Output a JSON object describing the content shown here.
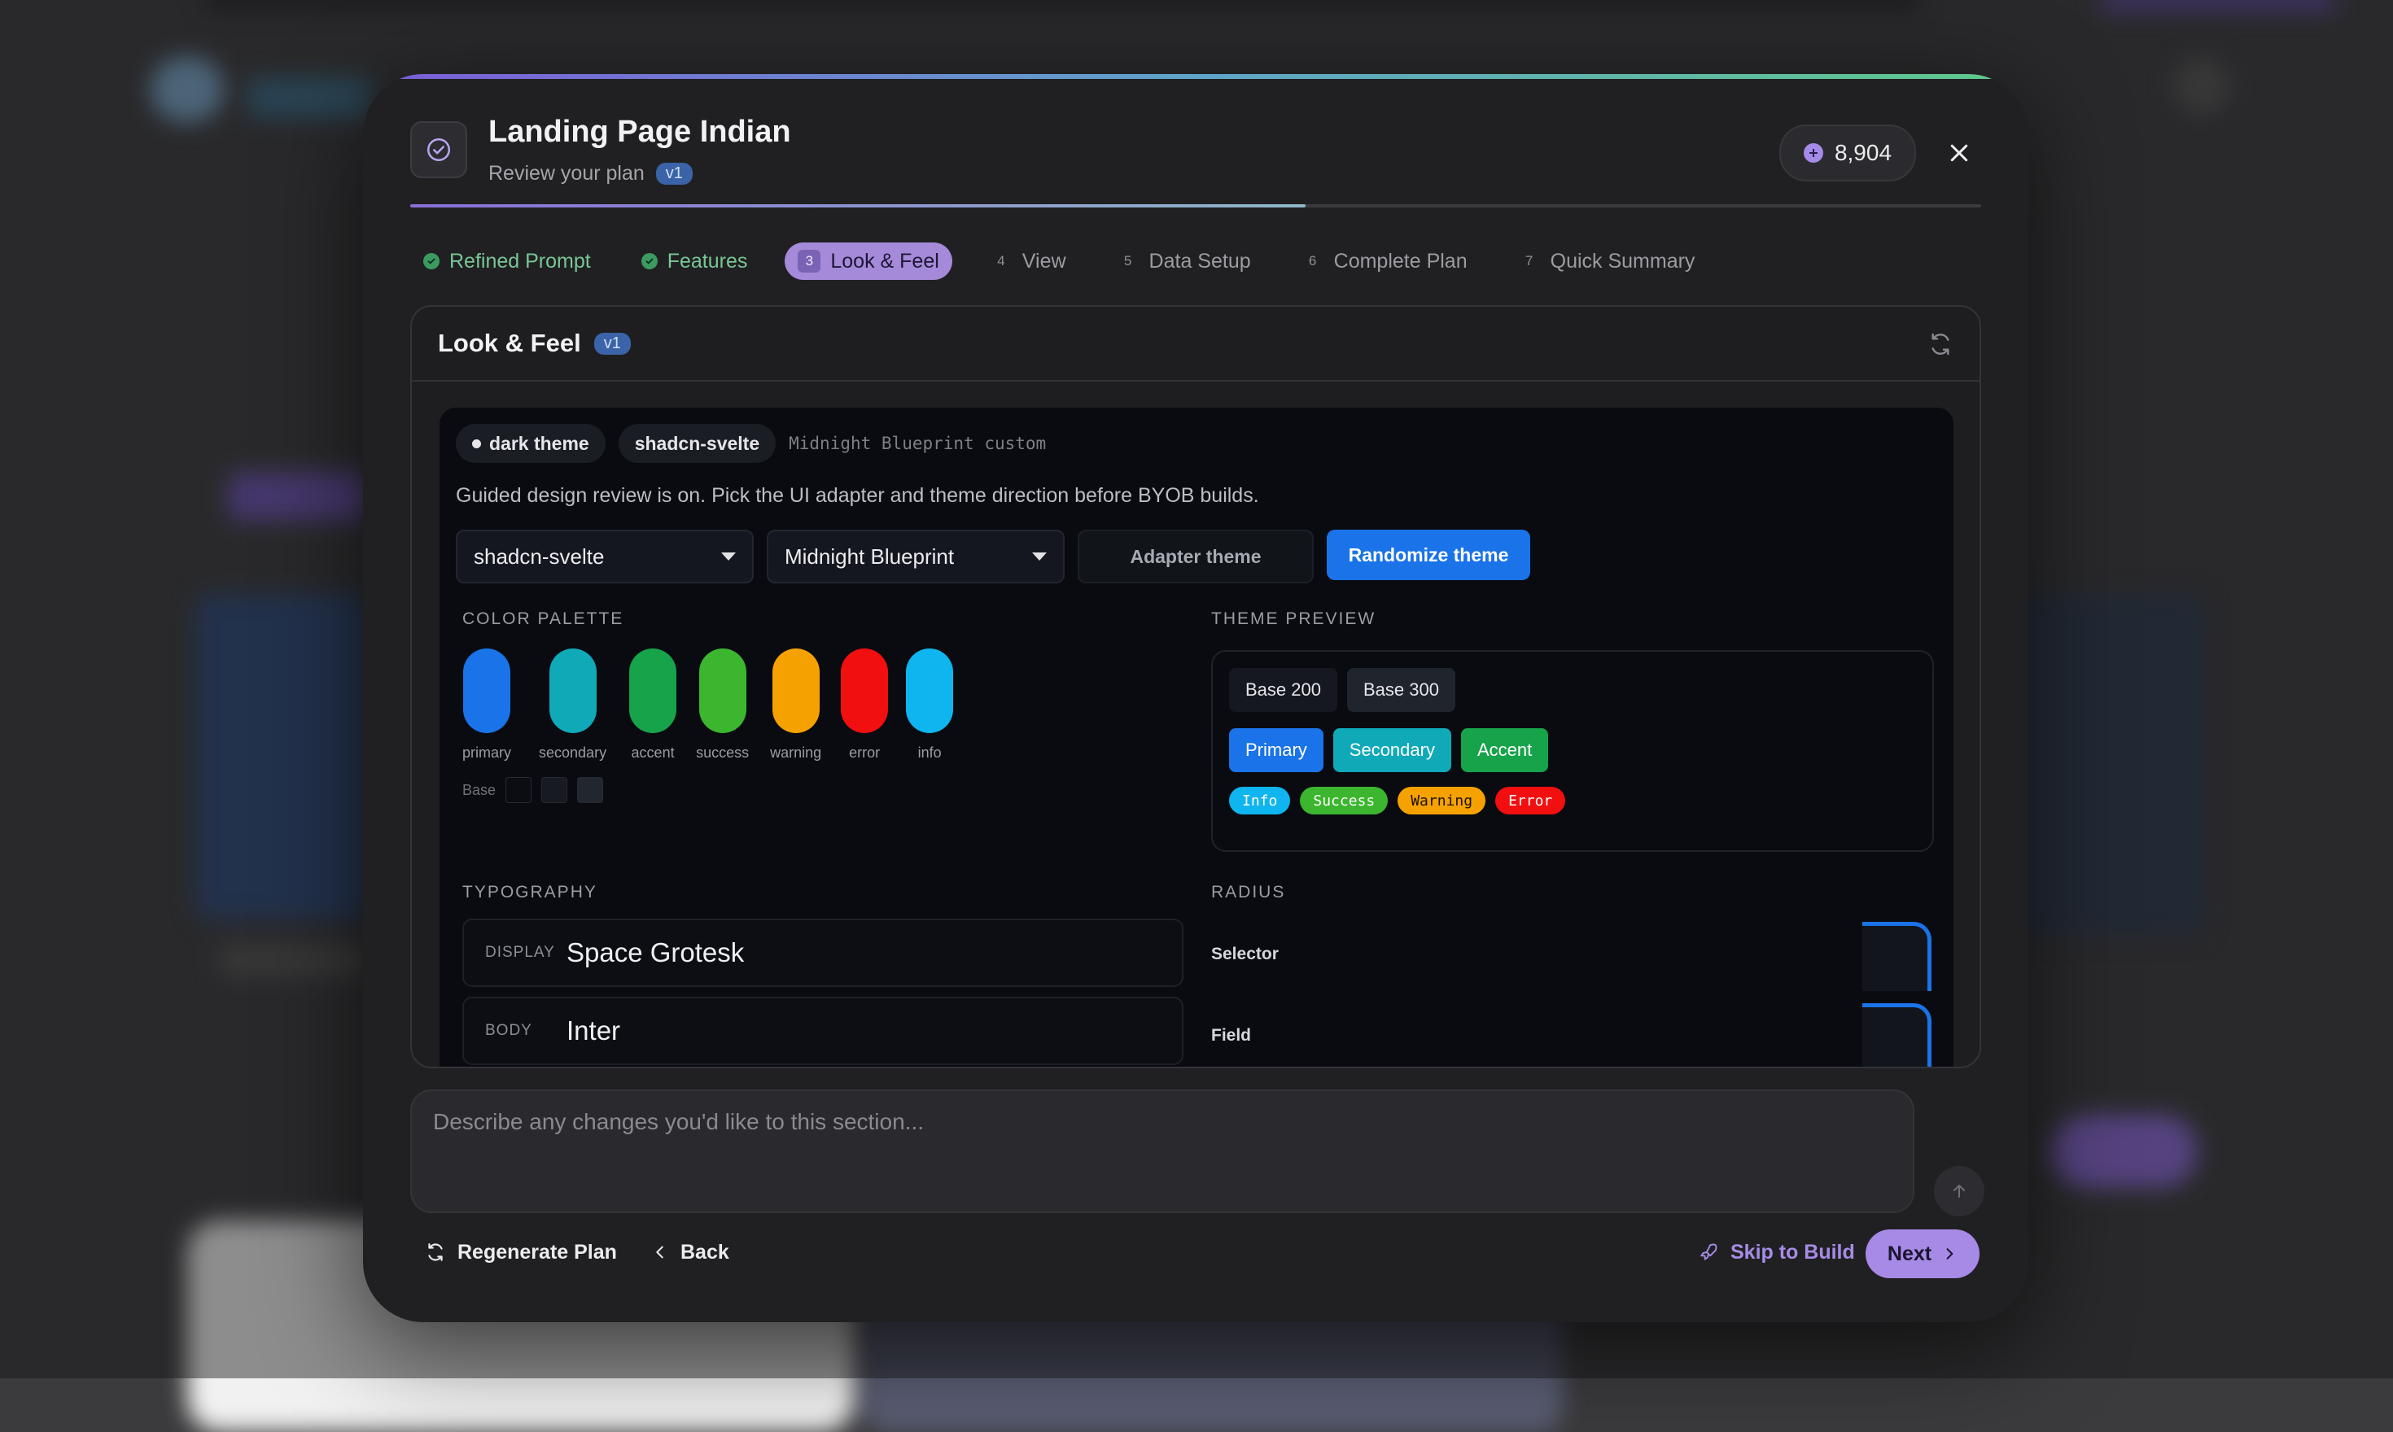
{
  "modal": {
    "title": "Landing Page Indian",
    "subtitle": "Review your plan",
    "version_badge": "v1",
    "credits": "8,904",
    "progress_fraction": 0.57
  },
  "steps": [
    {
      "label": "Refined Prompt",
      "state": "done",
      "num": ""
    },
    {
      "label": "Features",
      "state": "done",
      "num": ""
    },
    {
      "label": "Look & Feel",
      "state": "active",
      "num": "3"
    },
    {
      "label": "View",
      "state": "todo",
      "num": "4"
    },
    {
      "label": "Data Setup",
      "state": "todo",
      "num": "5"
    },
    {
      "label": "Complete Plan",
      "state": "todo",
      "num": "6"
    },
    {
      "label": "Quick Summary",
      "state": "todo",
      "num": "7"
    }
  ],
  "section": {
    "title": "Look & Feel",
    "version_badge": "v1",
    "tags": {
      "theme_mode": "dark theme",
      "adapter": "shadcn-svelte",
      "note": "Midnight Blueprint custom"
    },
    "guided_text": "Guided design review is on. Pick the UI adapter and theme direction before BYOB builds.",
    "adapter_select": "shadcn-svelte",
    "theme_select": "Midnight Blueprint",
    "adapter_theme_btn": "Adapter theme",
    "randomize_btn": "Randomize theme",
    "palette_label": "COLOR PALETTE",
    "palette": [
      {
        "name": "primary",
        "color": "#1a73e8"
      },
      {
        "name": "secondary",
        "color": "#0fa9b8"
      },
      {
        "name": "accent",
        "color": "#16a34a"
      },
      {
        "name": "success",
        "color": "#3bb62e"
      },
      {
        "name": "warning",
        "color": "#f5a200"
      },
      {
        "name": "error",
        "color": "#f10f0f"
      },
      {
        "name": "info",
        "color": "#0fb5ee"
      }
    ],
    "base_label": "Base",
    "base_colors": [
      "#0b0d12",
      "#171a21",
      "#22262e"
    ],
    "preview_label": "THEME PREVIEW",
    "preview": {
      "base200": "Base 200",
      "base300": "Base 300",
      "primary": "Primary",
      "secondary": "Secondary",
      "accent": "Accent",
      "badges": {
        "info": "Info",
        "success": "Success",
        "warning": "Warning",
        "error": "Error"
      }
    },
    "typography_label": "TYPOGRAPHY",
    "fonts": [
      {
        "kind": "DISPLAY",
        "name": "Space Grotesk"
      },
      {
        "kind": "BODY",
        "name": "Inter"
      }
    ],
    "radius_label": "RADIUS",
    "radius_items": [
      "Selector",
      "Field"
    ]
  },
  "input": {
    "placeholder": "Describe any changes you'd like to this section..."
  },
  "footer": {
    "regenerate": "Regenerate Plan",
    "back": "Back",
    "skip": "Skip to Build",
    "next": "Next"
  }
}
